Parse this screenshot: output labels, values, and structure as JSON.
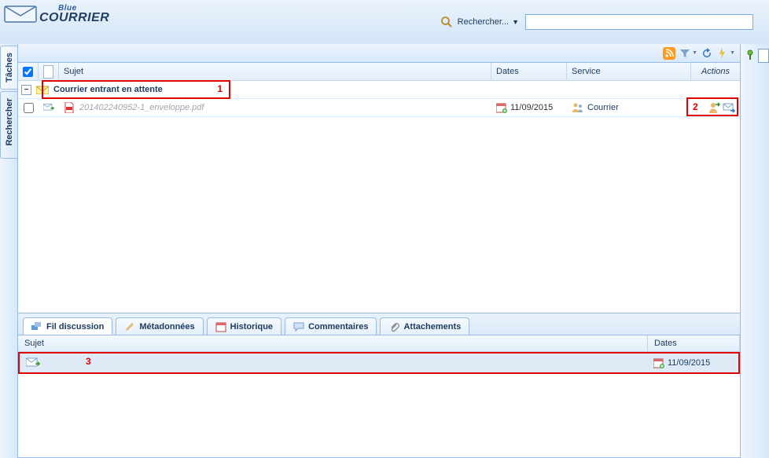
{
  "brand": {
    "blue": "Blue",
    "main": "COURRIER"
  },
  "search": {
    "label": "Rechercher...",
    "value": ""
  },
  "vtabs": {
    "tasks": "Tâches",
    "search": "Rechercher"
  },
  "gridHeaders": {
    "subject": "Sujet",
    "dates": "Dates",
    "service": "Service",
    "actions": "Actions"
  },
  "group": {
    "label": "Courrier entrant en attente"
  },
  "rows": [
    {
      "file": "201402240952-1_enveloppe.pdf",
      "date": "11/09/2015",
      "service": "Courrier"
    }
  ],
  "bottomTabs": {
    "discussion": "Fil discussion",
    "metadata": "Métadonnées",
    "history": "Historique",
    "comments": "Commentaires",
    "attachments": "Attachements"
  },
  "discussionHeaders": {
    "subject": "Sujet",
    "dates": "Dates"
  },
  "discussionRow": {
    "date": "11/09/2015"
  },
  "annotations": {
    "n1": "1",
    "n2": "2",
    "n3": "3"
  }
}
